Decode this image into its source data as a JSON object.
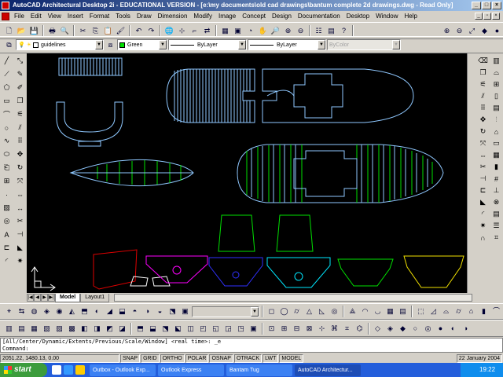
{
  "window": {
    "title": "AutoCAD Architectural Desktop 2i - EDUCATIONAL VERSION - [e:\\my documents\\old cad drawings\\bantum complete 2d drawings.dwg - Read Only]"
  },
  "menu": [
    "File",
    "Edit",
    "View",
    "Insert",
    "Format",
    "Tools",
    "Draw",
    "Dimension",
    "Modify",
    "Image",
    "Concept",
    "Design",
    "Documentation",
    "Desktop",
    "Window",
    "Help"
  ],
  "properties": {
    "layer": "guidelines",
    "color": "Green",
    "linetype": "ByLayer",
    "lineweight": "ByLayer",
    "plotstyle": "ByColor"
  },
  "tabs": [
    {
      "label": "Model",
      "active": true
    },
    {
      "label": "Layout1",
      "active": false
    }
  ],
  "command": {
    "line1": "[All/Center/Dynamic/Extents/Previous/Scale/Window] <real time>: _e",
    "line2": "Command:"
  },
  "status": {
    "coords": "2051.22, 1480.13, 0.00",
    "toggles": [
      "SNAP",
      "GRID",
      "ORTHO",
      "POLAR",
      "OSNAP",
      "OTRACK",
      "LWT",
      "MODEL"
    ],
    "date": "22 January 2004"
  },
  "taskbar": {
    "start": "start",
    "tasks": [
      {
        "label": "Outbox - Outlook Exp...",
        "active": false
      },
      {
        "label": "Outlook Express",
        "active": false
      },
      {
        "label": "Bantam Tug",
        "active": false
      },
      {
        "label": "AutoCAD Architectur...",
        "active": true
      }
    ],
    "time": "19:22"
  },
  "colors": {
    "title_start": "#0a246a",
    "canvas": "#000000",
    "hull": "#8fc8ff",
    "green": "#00e000",
    "red": "#e00000",
    "magenta": "#ff00ff",
    "blue": "#3030ff",
    "cyan": "#00e8ff",
    "yellow": "#f0e000",
    "white": "#ffffff"
  }
}
